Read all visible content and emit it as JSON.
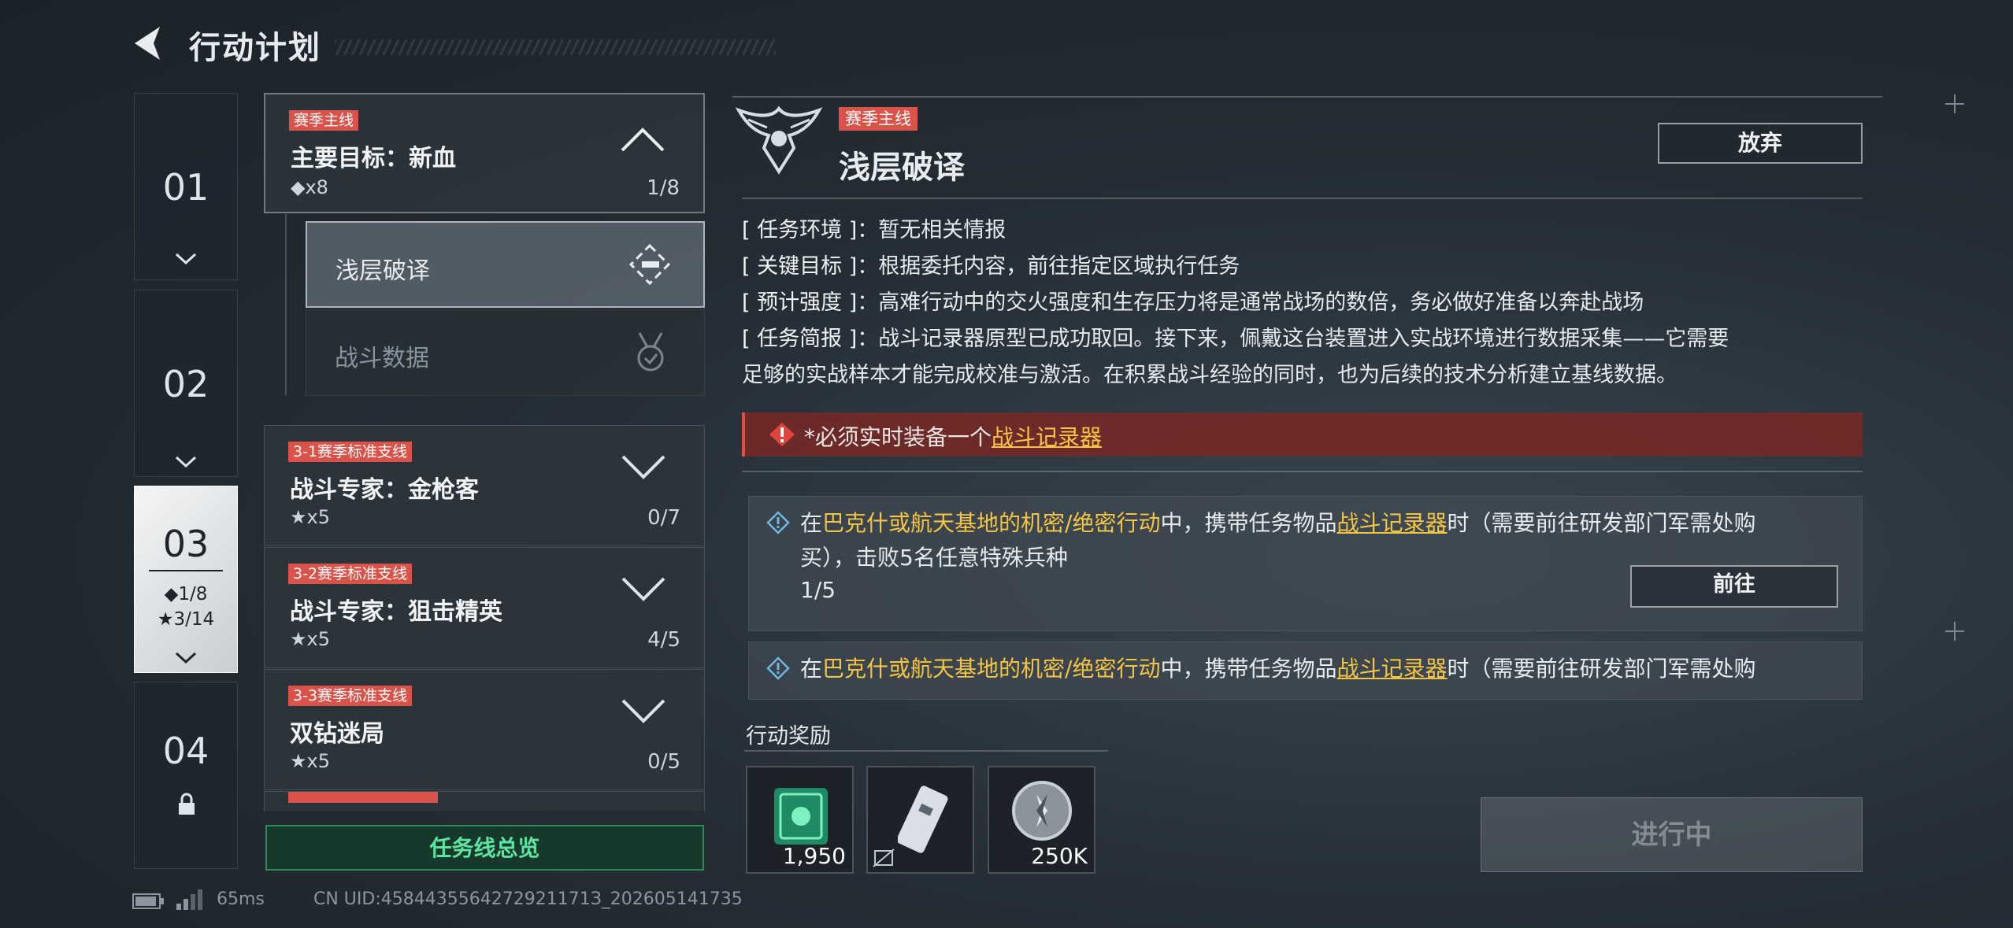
{
  "header": {
    "title": "行动计划"
  },
  "chapters": [
    {
      "num": "01"
    },
    {
      "num": "02"
    },
    {
      "num": "03",
      "main_progress": "◆1/8",
      "star_progress": "★3/14"
    },
    {
      "num": "04"
    }
  ],
  "main_task": {
    "tag": "赛季主线",
    "name": "主要目标：新血",
    "count": "◆x8",
    "progress": "1/8"
  },
  "subtasks": [
    {
      "label": "浅层破译"
    },
    {
      "label": "战斗数据"
    }
  ],
  "side_tasks": [
    {
      "tag": "3-1赛季标准支线",
      "name": "战斗专家：金枪客",
      "count": "★x5",
      "progress": "0/7"
    },
    {
      "tag": "3-2赛季标准支线",
      "name": "战斗专家：狙击精英",
      "count": "★x5",
      "progress": "4/5"
    },
    {
      "tag": "3-3赛季标准支线",
      "name": "双钻迷局",
      "count": "★x5",
      "progress": "0/5"
    }
  ],
  "overview_button": "任务线总览",
  "detail": {
    "tag": "赛季主线",
    "title": "浅层破译",
    "abandon_label": "放弃",
    "env_key": "[ 任务环境 ]",
    "env_val": "：暂无相关情报",
    "goal_key": "[ 关键目标 ]",
    "goal_val": "：根据委托内容，前往指定区域执行任务",
    "intensity_key": "[ 预计强度 ]",
    "intensity_val": "：高难行动中的交火强度和生存压力将是通常战场的数倍，务必做好准备以奔赴战场",
    "brief_key": "[ 任务简报 ]",
    "brief_val": "：战斗记录器原型已成功取回。接下来，佩戴这台装置进入实战环境进行数据采集——它需要",
    "brief_val2": "足够的实战样本才能完成校准与激活。在积累战斗经验的同时，也为后续的技术分析建立基线数据。",
    "warning_prefix": "*必须实时装备一个",
    "warning_link": "战斗记录器"
  },
  "objectives": [
    {
      "pre": "在",
      "place": "巴克什或航天基地的机密/绝密行动",
      "mid": "中，携带任务物品",
      "item": "战斗记录器",
      "post": "时（需要前往研发部门军需处购",
      "line2": "买），击败5名任意特殊兵种",
      "progress": "1/5",
      "goto_label": "前往"
    },
    {
      "pre": "在",
      "place": "巴克什或航天基地的机密/绝密行动",
      "mid": "中，携带任务物品",
      "item": "战斗记录器",
      "post": "时（需要前往研发部门军需处购"
    }
  ],
  "rewards": {
    "title": "行动奖励",
    "items": [
      {
        "value": "1,950"
      },
      {
        "value": ""
      },
      {
        "value": "250K"
      }
    ]
  },
  "in_progress_label": "进行中",
  "footer": {
    "ping": "65ms",
    "uid": "CN UID:4584435564272921171З_202605141735"
  },
  "colors": {
    "tag_red": "#d9534a",
    "highlight": "#f4c545",
    "green": "#5fe3a0"
  }
}
